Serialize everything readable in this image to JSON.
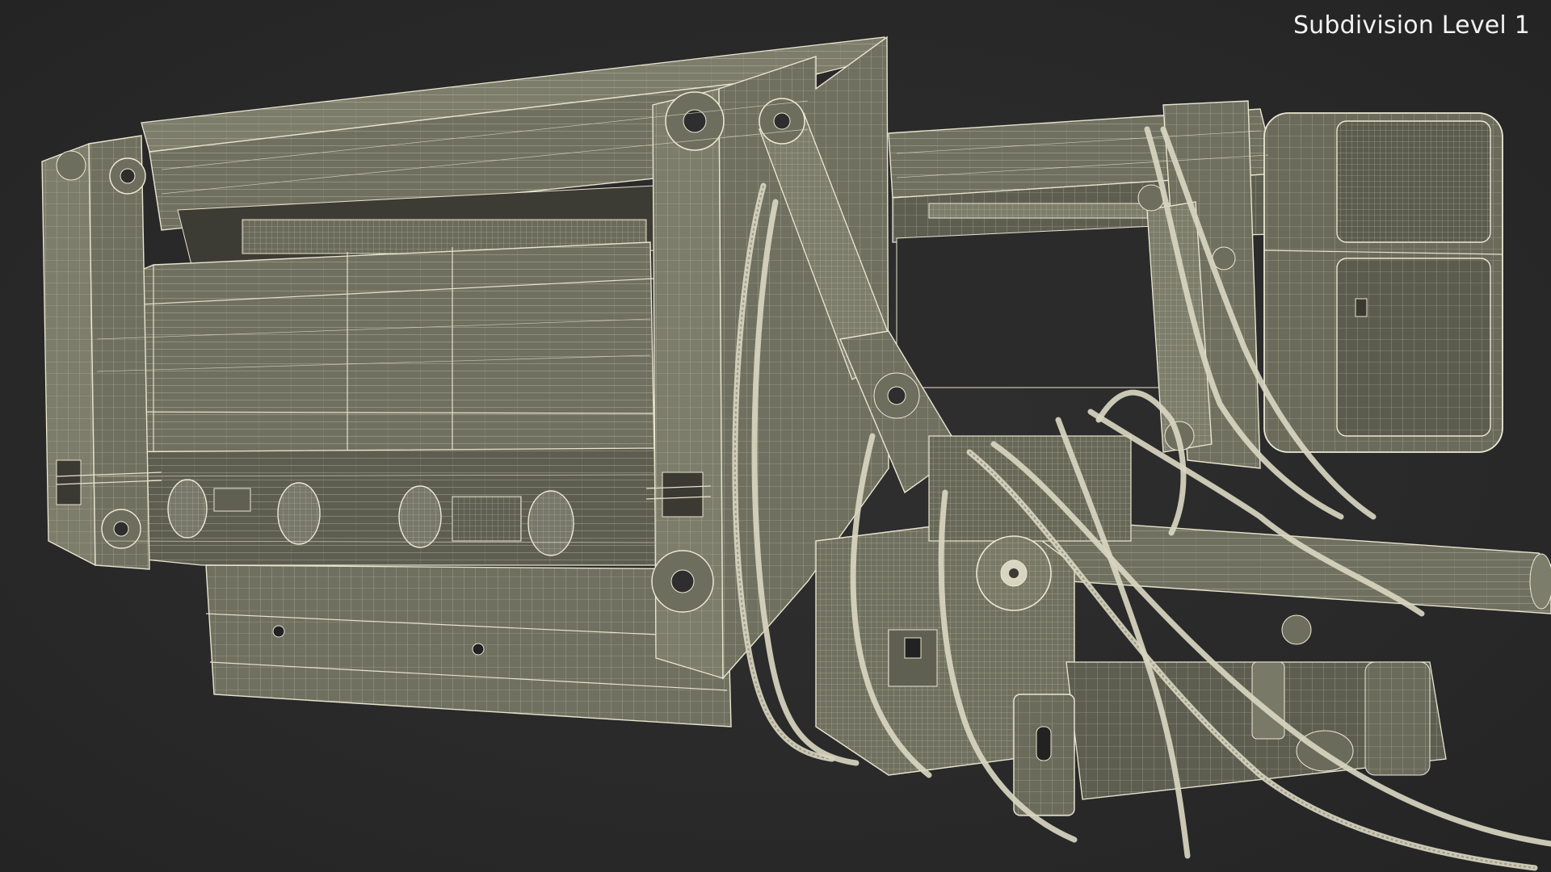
{
  "overlay": {
    "subdivision_label": "Subdivision Level 1"
  },
  "scene": {
    "background_color": "#2a2a2a",
    "wireframe_color": "#e8e5d0",
    "surface_color": "#6f705f"
  }
}
